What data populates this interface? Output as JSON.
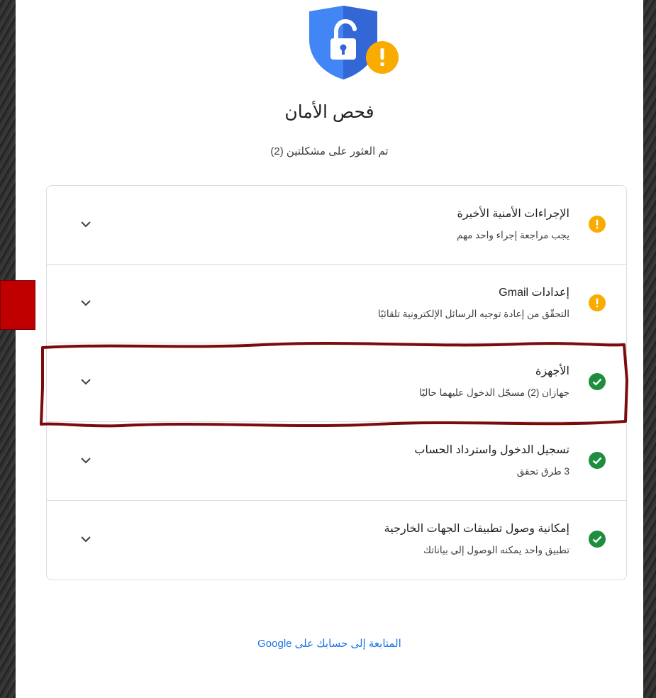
{
  "header": {
    "title": "فحص الأمان",
    "subtitle": "تم العثور على مشكلتين (2)",
    "shield_icon": "shield-lock-warning-icon"
  },
  "colors": {
    "warning": "#F9AB00",
    "success": "#1E8E3E",
    "shield_blue": "#4285F4",
    "link": "#1A73E8",
    "annotation_red": "#C00000"
  },
  "items": [
    {
      "title": "الإجراءات الأمنية الأخيرة",
      "description": "يجب مراجعة إجراء واحد مهم",
      "status": "warning"
    },
    {
      "title": "إعدادات Gmail",
      "description": "التحقّق من إعادة توجيه الرسائل الإلكترونية تلقائيًا",
      "status": "warning"
    },
    {
      "title": "الأجهزة",
      "description": "جهازان (2) مسجّل الدخول عليهما حاليًا",
      "status": "ok"
    },
    {
      "title": "تسجيل الدخول واسترداد الحساب",
      "description": "3 طرق تحقق",
      "status": "ok"
    },
    {
      "title": "إمكانية وصول تطبيقات الجهات الخارجية",
      "description": "تطبيق واحد يمكنه الوصول إلى بياناتك",
      "status": "ok"
    }
  ],
  "footer": {
    "continue_link": "المتابعة إلى حسابك على Google"
  }
}
